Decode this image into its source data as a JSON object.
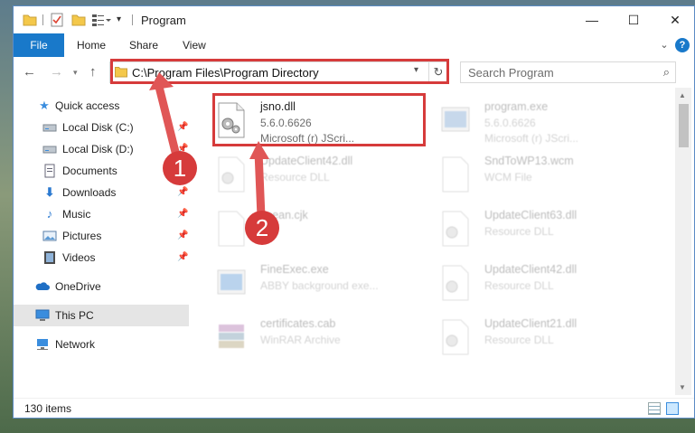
{
  "window": {
    "title": "Program",
    "minimize_glyph": "—",
    "maximize_glyph": "☐",
    "close_glyph": "✕"
  },
  "ribbon": {
    "tabs": [
      "File",
      "Home",
      "Share",
      "View"
    ]
  },
  "navbar": {
    "address": "C:\\Program Files\\Program Directory",
    "search_placeholder": "Search Program"
  },
  "sidebar": {
    "items": [
      {
        "label": "Quick access",
        "icon": "star-icon"
      },
      {
        "label": "Local Disk (C:)",
        "icon": "drive-icon",
        "pinned": true
      },
      {
        "label": "Local Disk (D:)",
        "icon": "drive-icon",
        "pinned": true
      },
      {
        "label": "Documents",
        "icon": "document-icon",
        "pinned": true
      },
      {
        "label": "Downloads",
        "icon": "download-icon",
        "pinned": true
      },
      {
        "label": "Music",
        "icon": "music-icon",
        "pinned": true
      },
      {
        "label": "Pictures",
        "icon": "picture-icon",
        "pinned": true
      },
      {
        "label": "Videos",
        "icon": "video-icon",
        "pinned": true
      },
      {
        "label": "OneDrive",
        "icon": "cloud-icon"
      },
      {
        "label": "This PC",
        "icon": "computer-icon",
        "selected": true
      },
      {
        "label": "Network",
        "icon": "network-icon"
      }
    ]
  },
  "files": [
    {
      "name": "jsno.dll",
      "type": "5.6.0.6626",
      "desc": "Microsoft (r) JScri...",
      "icon": "dll-gear-icon",
      "highlighted": true
    },
    {
      "name": "program.exe",
      "type": "5.6.0.6626",
      "desc": "Microsoft (r) JScri...",
      "icon": "exe-icon"
    },
    {
      "name": "UpdateClient42.dll",
      "type": "Resource DLL",
      "desc": "",
      "icon": "dll-gear-icon"
    },
    {
      "name": "SndToWP13.wcm",
      "type": "WCM File",
      "desc": "",
      "icon": "file-icon"
    },
    {
      "name": "ocean.cjk",
      "type": "File",
      "desc": "",
      "icon": "file-icon"
    },
    {
      "name": "UpdateClient63.dll",
      "type": "Resource DLL",
      "desc": "",
      "icon": "dll-gear-icon"
    },
    {
      "name": "FineExec.exe",
      "type": "ABBY background exe...",
      "desc": "",
      "icon": "exe-icon"
    },
    {
      "name": "UpdateClient42.dll",
      "type": "Resource DLL",
      "desc": "",
      "icon": "dll-gear-icon"
    },
    {
      "name": "certificates.cab",
      "type": "WinRAR Archive",
      "desc": "",
      "icon": "archive-icon"
    },
    {
      "name": "UpdateClient21.dll",
      "type": "Resource DLL",
      "desc": "",
      "icon": "dll-gear-icon"
    }
  ],
  "status": {
    "item_count": "130 items"
  },
  "annotations": {
    "step1": "1",
    "step2": "2",
    "color": "#d63b3b"
  }
}
